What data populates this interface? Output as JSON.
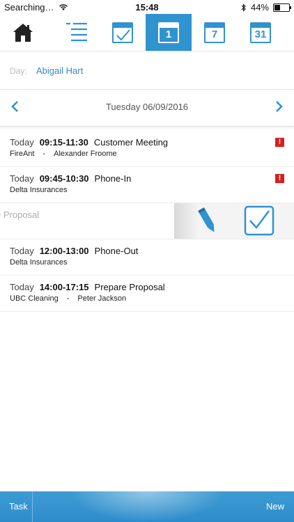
{
  "status": {
    "carrier": "Searching…",
    "time": "15:48",
    "battery": "44%",
    "battery_level": 0.44
  },
  "toolbar": {
    "day_badge": "1",
    "week_badge": "7",
    "month_badge": "31"
  },
  "day": {
    "label": "Day:",
    "value": "Abigail Hart"
  },
  "date_nav": {
    "date": "Tuesday  06/09/2016"
  },
  "appointments": [
    {
      "day": "Today",
      "time": "09:15-11:30",
      "title": "Customer Meeting",
      "company": "FireAnt",
      "separator": "-",
      "contact": "Alexander Froome",
      "alert": "!"
    },
    {
      "day": "Today",
      "time": "09:45-10:30",
      "title": "Phone-In",
      "company": "Delta Insurances",
      "alert": "!"
    },
    {
      "ghost": "e Proposal"
    },
    {
      "day": "Today",
      "time": "12:00-13:00",
      "title": "Phone-Out",
      "company": "Delta Insurances"
    },
    {
      "day": "Today",
      "time": "14:00-17:15",
      "title": "Prepare Proposal",
      "company": "UBC Cleaning",
      "separator": "-",
      "contact": "Peter Jackson"
    }
  ],
  "bottom": {
    "task_label": "Task",
    "new_label": "New"
  },
  "colors": {
    "accent": "#2f93cf",
    "alert": "#d81f1f",
    "link": "#3a86c4"
  }
}
